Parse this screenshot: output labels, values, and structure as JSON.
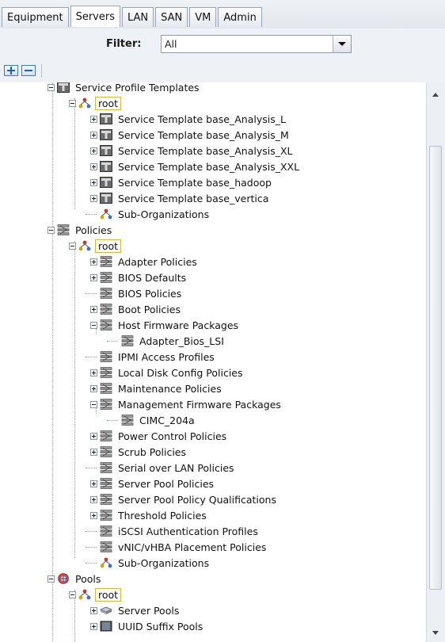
{
  "tabs": [
    "Equipment",
    "Servers",
    "LAN",
    "SAN",
    "VM",
    "Admin"
  ],
  "active_tab": "Servers",
  "filter": {
    "label": "Filter:",
    "value": "All"
  },
  "tree": {
    "service_profile_templates": "Service Profile Templates",
    "root_label": "root",
    "templates": [
      "Service Template base_Analysis_L",
      "Service Template base_Analysis_M",
      "Service Template base_Analysis_XL",
      "Service Template base_Analysis_XXL",
      "Service Template base_hadoop",
      "Service Template base_vertica"
    ],
    "sub_organizations": "Sub-Organizations",
    "policies": "Policies",
    "policy_items": [
      "Adapter Policies",
      "BIOS Defaults",
      "BIOS Policies",
      "Boot Policies",
      "Host Firmware Packages",
      "Adapter_Bios_LSI",
      "IPMI Access Profiles",
      "Local Disk Config Policies",
      "Maintenance Policies",
      "Management Firmware Packages",
      "CIMC_204a",
      "Power Control Policies",
      "Scrub Policies",
      "Serial over LAN Policies",
      "Server Pool Policies",
      "Server Pool Policy Qualifications",
      "Threshold Policies",
      "iSCSI Authentication Profiles",
      "vNIC/vHBA Placement Policies"
    ],
    "pools": "Pools",
    "pool_items": [
      "Server Pools",
      "UUID Suffix Pools"
    ]
  },
  "icons": {
    "template": "template-icon",
    "org": "org-icon",
    "policy": "policy-icon",
    "pools": "pools-icon",
    "server_pool": "server-pool-icon",
    "uuid_pool": "uuid-pool-icon"
  },
  "colors": {
    "accent": "#3b77c2",
    "selection_box": "#e2b33a"
  }
}
